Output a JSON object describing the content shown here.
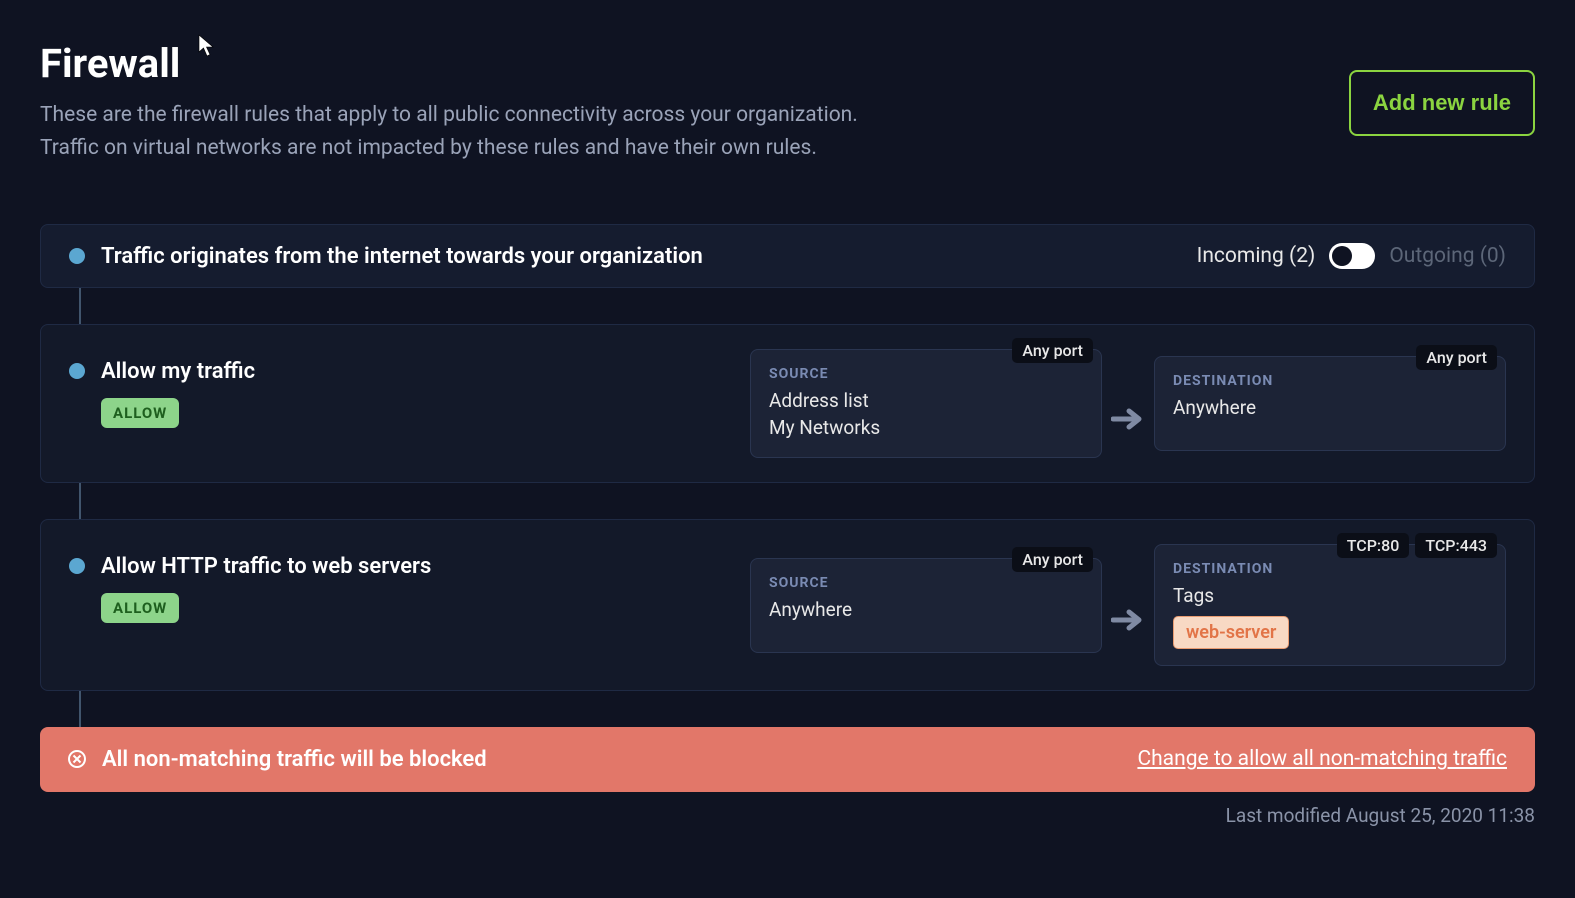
{
  "header": {
    "title": "Firewall",
    "description_line1": "These are the firewall rules that apply to all public connectivity across your organization.",
    "description_line2": "Traffic on virtual networks are not impacted by these rules and have their own rules.",
    "add_rule_label": "Add new rule"
  },
  "direction_section": {
    "summary": "Traffic originates from the internet towards your organization",
    "incoming_label": "Incoming (2)",
    "outgoing_label": "Outgoing (0)"
  },
  "rules": [
    {
      "name": "Allow my traffic",
      "action_badge": "ALLOW",
      "source": {
        "label": "SOURCE",
        "heading": "Address list",
        "value": "My Networks",
        "ports": [
          "Any port"
        ]
      },
      "destination": {
        "label": "DESTINATION",
        "heading": "Anywhere",
        "ports": [
          "Any port"
        ],
        "tags": []
      }
    },
    {
      "name": "Allow HTTP traffic to web servers",
      "action_badge": "ALLOW",
      "source": {
        "label": "SOURCE",
        "heading": "Anywhere",
        "value": "",
        "ports": [
          "Any port"
        ]
      },
      "destination": {
        "label": "DESTINATION",
        "heading": "Tags",
        "ports": [
          "TCP:80",
          "TCP:443"
        ],
        "tags": [
          "web-server"
        ]
      }
    }
  ],
  "default_policy": {
    "message": "All non-matching traffic will be blocked",
    "change_link": "Change to allow all non-matching traffic"
  },
  "footer": {
    "last_modified": "Last modified August 25, 2020 11:38"
  }
}
